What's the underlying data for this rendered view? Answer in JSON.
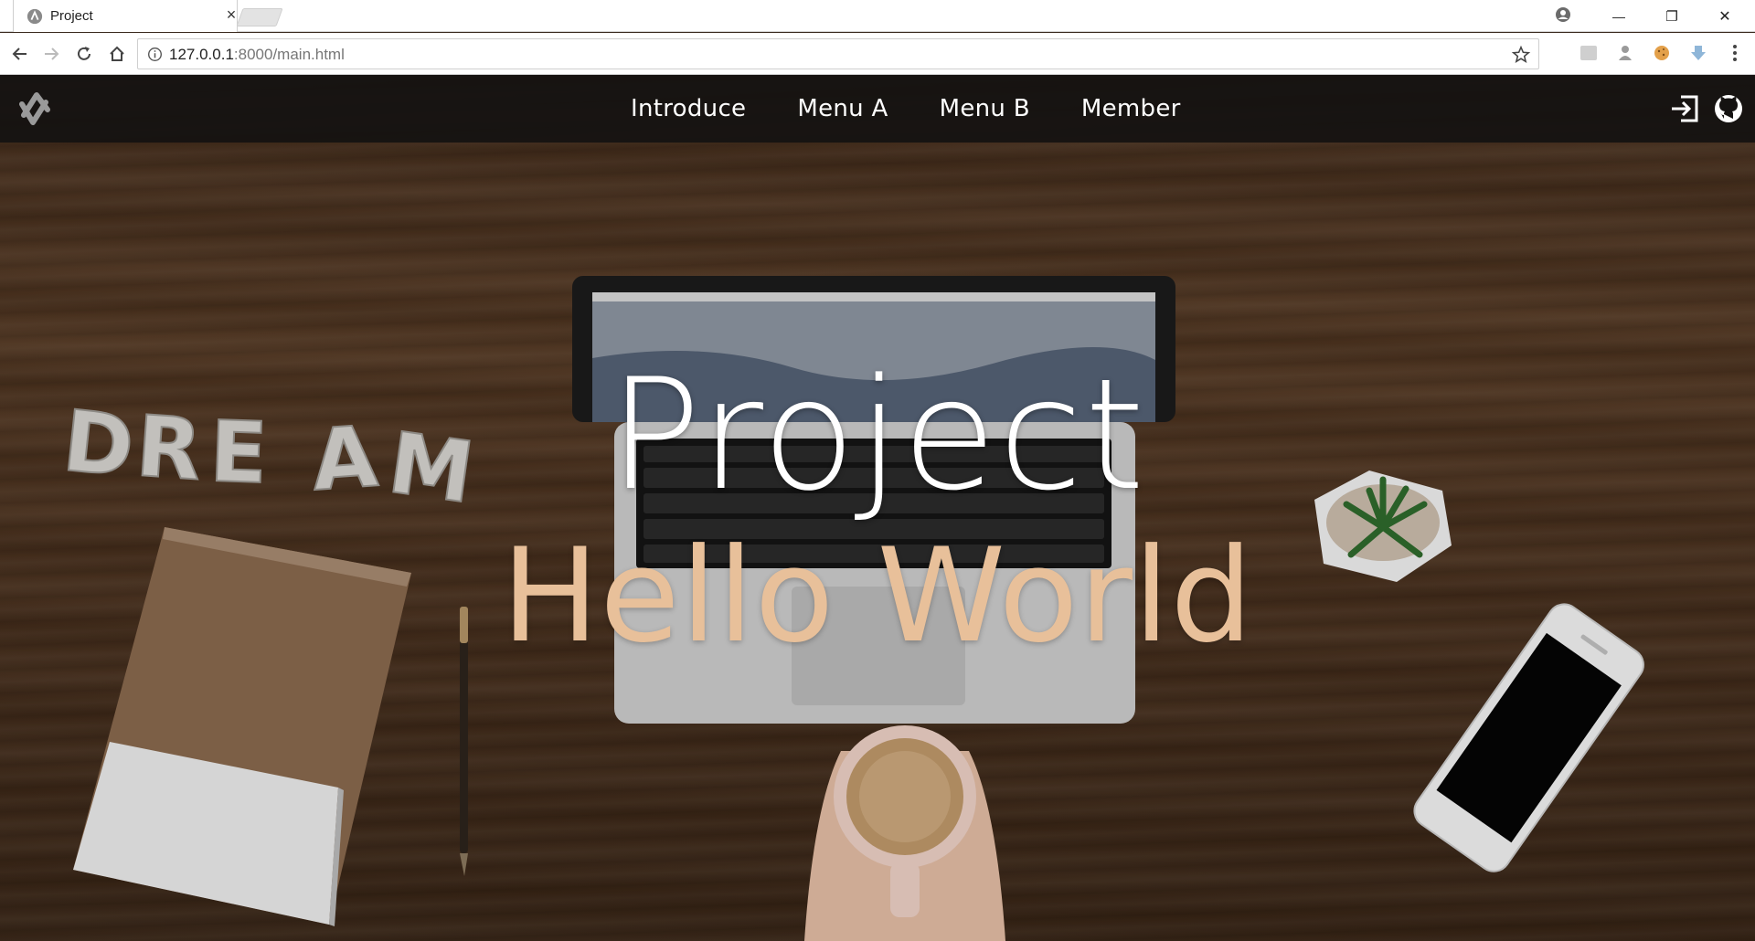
{
  "browser": {
    "tab": {
      "title": "Project",
      "close_label": "×"
    },
    "address": {
      "host": "127.0.0.1",
      "path": ":8000/main.html"
    },
    "window_controls": {
      "minimize": "—",
      "restore": "❐",
      "close": "✕"
    }
  },
  "site": {
    "nav": {
      "links": [
        "Introduce",
        "Menu A",
        "Menu B",
        "Member"
      ]
    },
    "hero": {
      "title": "Project",
      "subtitle": "Hello World"
    }
  },
  "colors": {
    "navbar_bg": "#141211",
    "hero_subtitle": "#e8c09a",
    "hero_title": "#ffffff"
  },
  "icons": [
    "back-icon",
    "forward-icon",
    "reload-icon",
    "home-icon",
    "info-icon",
    "star-icon",
    "login-icon",
    "github-icon",
    "profile-icon"
  ]
}
